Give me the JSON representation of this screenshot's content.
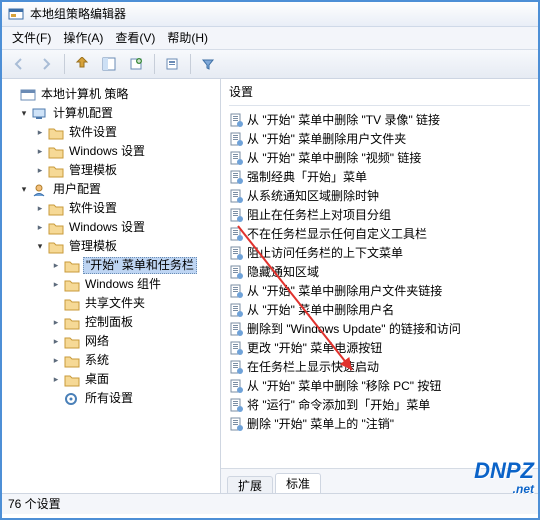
{
  "window": {
    "title": "本地组策略编辑器"
  },
  "menu": {
    "file": "文件(F)",
    "action": "操作(A)",
    "view": "查看(V)",
    "help": "帮助(H)"
  },
  "tree": {
    "root": "本地计算机 策略",
    "computer": "计算机配置",
    "comp_soft": "软件设置",
    "comp_win": "Windows 设置",
    "comp_tmpl": "管理模板",
    "user": "用户配置",
    "user_soft": "软件设置",
    "user_win": "Windows 设置",
    "user_tmpl": "管理模板",
    "start_taskbar": "\"开始\" 菜单和任务栏",
    "win_comp": "Windows 组件",
    "shared": "共享文件夹",
    "ctrl": "控制面板",
    "net": "网络",
    "sys": "系统",
    "desktop": "桌面",
    "allset": "所有设置"
  },
  "right": {
    "header": "设置",
    "items": [
      "从 \"开始\" 菜单中删除 \"TV 录像\" 链接",
      "从 \"开始\" 菜单删除用户文件夹",
      "从 \"开始\" 菜单中删除 \"视频\" 链接",
      "强制经典「开始」菜单",
      "从系统通知区域删除时钟",
      "阻止在任务栏上对项目分组",
      "不在任务栏显示任何自定义工具栏",
      "阻止访问任务栏的上下文菜单",
      "隐藏通知区域",
      "从 \"开始\" 菜单中删除用户文件夹链接",
      "从 \"开始\" 菜单中删除用户名",
      "删除到 \"Windows Update\" 的链接和访问",
      "更改 \"开始\" 菜单电源按钮",
      "在任务栏上显示快速启动",
      "从 \"开始\" 菜单中删除 \"移除 PC\" 按钮",
      "将 \"运行\" 命令添加到「开始」菜单",
      "删除 \"开始\" 菜单上的 \"注销\""
    ]
  },
  "tabs": {
    "extended": "扩展",
    "standard": "标准"
  },
  "status": {
    "count": "76 个设置"
  },
  "brand": {
    "name": "DNPZ",
    "sub": ".net"
  }
}
